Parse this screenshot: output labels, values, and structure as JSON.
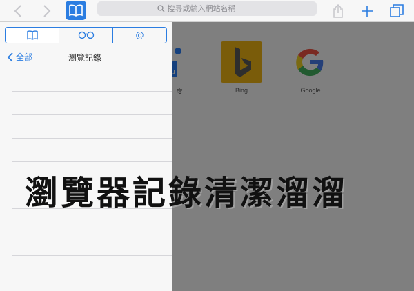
{
  "toolbar": {
    "address_placeholder": "搜尋或輸入網站名稱",
    "back_icon": "chevron-left-icon",
    "forward_icon": "chevron-right-icon",
    "bookmarks_icon": "book-icon",
    "share_icon": "share-icon",
    "add_icon": "plus-icon",
    "tabs_icon": "tabs-icon",
    "accent": "#2b7de1"
  },
  "sidebar": {
    "segments": [
      {
        "icon": "book-icon"
      },
      {
        "icon": "glasses-icon"
      },
      {
        "icon": "at-icon",
        "label": "@"
      }
    ],
    "back_label": "全部",
    "title": "瀏覽記錄"
  },
  "favorites": [
    {
      "label": "度",
      "color": "#2b7de1"
    },
    {
      "label": "Bing",
      "color": "#f5b400"
    },
    {
      "label": "Google",
      "color": "#ffffff"
    }
  ],
  "caption": "瀏覽器記錄清潔溜溜"
}
